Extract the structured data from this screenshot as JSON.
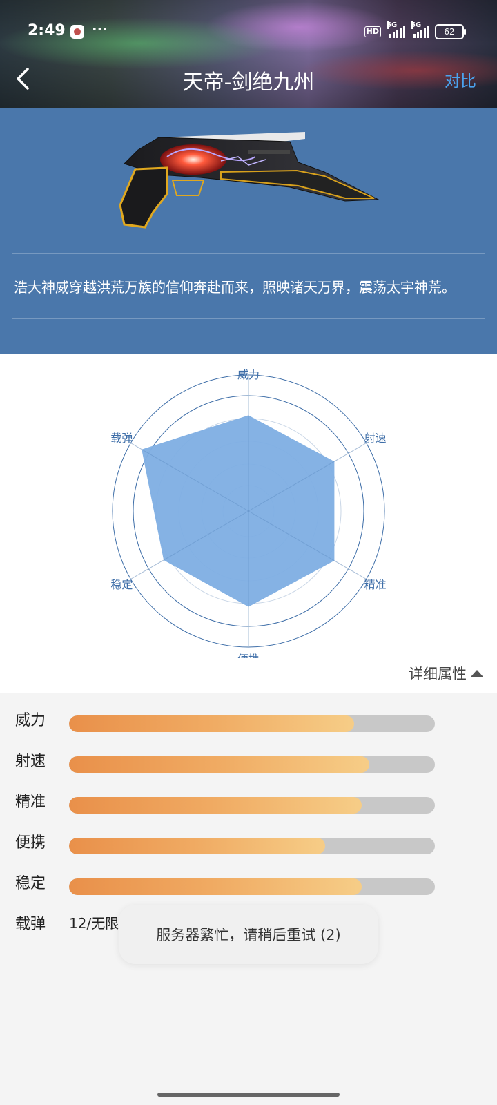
{
  "status": {
    "time": "2:49",
    "more": "···",
    "hd": "HD",
    "net1": "5G",
    "net2": "5G",
    "battery": "62"
  },
  "header": {
    "title": "天帝-剑绝九州",
    "compare": "对比"
  },
  "weapon": {
    "description": "浩大神威穿越洪荒万族的信仰奔赴而来，照映诸天万界，震荡太宇神荒。"
  },
  "radar": {
    "axes": [
      "威力",
      "射速",
      "精准",
      "便携",
      "稳定",
      "载弹"
    ],
    "values": [
      0.83,
      0.86,
      0.86,
      0.83,
      0.85,
      1.07
    ],
    "fill_color": "#7eaee3",
    "line_color": "#3e6ea8"
  },
  "detail_toggle": {
    "label": "详细属性"
  },
  "stats": [
    {
      "label": "威力",
      "value": 0.78
    },
    {
      "label": "射速",
      "value": 0.82
    },
    {
      "label": "精准",
      "value": 0.8
    },
    {
      "label": "便携",
      "value": 0.7
    },
    {
      "label": "稳定",
      "value": 0.8
    }
  ],
  "ammo": {
    "label": "载弹",
    "value": "12/无限"
  },
  "toast": {
    "message": "服务器繁忙，请稍后重试 (2)"
  },
  "colors": {
    "header_blue": "#4a77ab",
    "accent": "#4aa3ef",
    "bar_start": "#e9904a",
    "bar_end": "#f6cd87"
  }
}
